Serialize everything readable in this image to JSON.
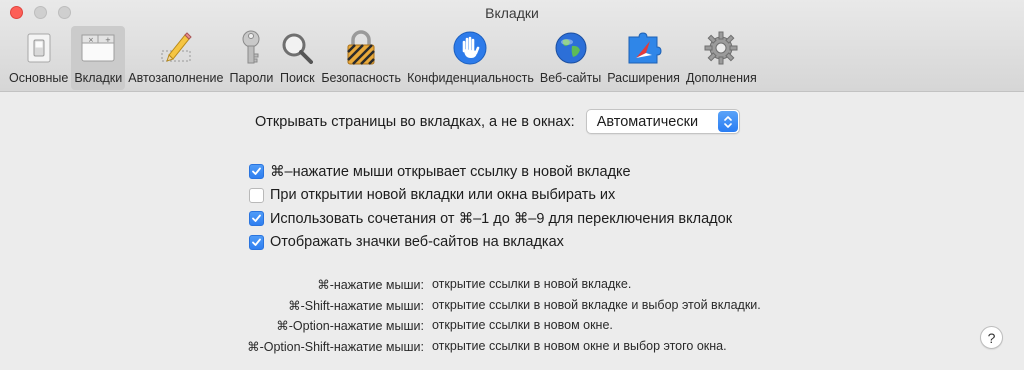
{
  "window": {
    "title": "Вкладки"
  },
  "toolbar": {
    "items": [
      {
        "label": "Основные",
        "icon": "general-switch-icon"
      },
      {
        "label": "Вкладки",
        "icon": "tabs-icon",
        "active": true
      },
      {
        "label": "Автозаполнение",
        "icon": "pencil-icon"
      },
      {
        "label": "Пароли",
        "icon": "key-icon"
      },
      {
        "label": "Поиск",
        "icon": "magnifier-icon"
      },
      {
        "label": "Безопасность",
        "icon": "padlock-icon"
      },
      {
        "label": "Конфиденциальность",
        "icon": "hand-icon"
      },
      {
        "label": "Веб-сайты",
        "icon": "globe-icon"
      },
      {
        "label": "Расширения",
        "icon": "puzzle-compass-icon"
      },
      {
        "label": "Дополнения",
        "icon": "gear-icon"
      }
    ]
  },
  "open_tabs": {
    "label": "Открывать страницы во вкладках, а не в окнах:",
    "selected": "Автоматически"
  },
  "checkboxes": [
    {
      "label": "⌘–нажатие мыши открывает ссылку в новой вкладке",
      "checked": true
    },
    {
      "label": "При открытии новой вкладки или окна выбирать их",
      "checked": false
    },
    {
      "label": "Использовать сочетания от ⌘–1 до ⌘–9 для переключения вкладок",
      "checked": true
    },
    {
      "label": "Отображать значки веб-сайтов на вкладках",
      "checked": true
    }
  ],
  "shortcuts": [
    {
      "key": "⌘-нажатие мыши:",
      "value": "открытие ссылки в новой вкладке."
    },
    {
      "key": "⌘-Shift-нажатие мыши:",
      "value": "открытие ссылки в новой вкладке и выбор этой вкладки."
    },
    {
      "key": "⌘-Option-нажатие мыши:",
      "value": "открытие ссылки в новом окне."
    },
    {
      "key": "⌘-Option-Shift-нажатие мыши:",
      "value": "открытие ссылки в новом окне и выбор этого окна."
    }
  ],
  "help": {
    "label": "?"
  },
  "colors": {
    "accent": "#2f7ff0",
    "close": "#fd5f57"
  }
}
